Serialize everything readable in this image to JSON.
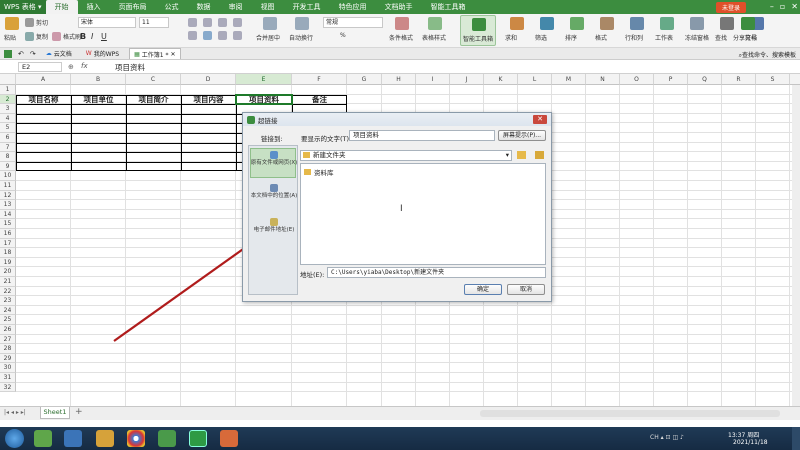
{
  "app": {
    "menu_label": "WPS 表格",
    "tabs": [
      "开始",
      "插入",
      "页面布局",
      "公式",
      "数据",
      "审阅",
      "视图",
      "开发工具",
      "特色应用",
      "文档助手",
      "智能工具箱"
    ],
    "active_tab": "开始",
    "login_label": "未登录"
  },
  "ribbon": {
    "paste": "粘贴",
    "cut": "剪切",
    "copy": "复制",
    "format_painter": "格式刷",
    "font_name": "宋体",
    "font_size": "11",
    "bold": "B",
    "italic": "I",
    "underline": "U",
    "merge_center": "合并居中",
    "wrap_text": "自动换行",
    "number_format": "常规",
    "percent": "%",
    "conditional_format": "条件格式",
    "table_style": "表格样式",
    "smart_toolbox": "智能工具箱",
    "sum": "求和",
    "filter": "筛选",
    "sort": "排序",
    "format": "格式",
    "row_col": "行和列",
    "worksheet": "工作表",
    "freeze": "冻结窗格",
    "find": "查找",
    "symbol": "符号",
    "share": "分享文档"
  },
  "doc_tabs": [
    {
      "label": "云文档",
      "active": false
    },
    {
      "label": "我的WPS",
      "active": false
    },
    {
      "label": "工作簿1 *",
      "active": true
    }
  ],
  "search_hint": "查找命令、搜索模板",
  "formula_bar": {
    "cell_ref": "E2",
    "fx": "fx",
    "content": "项目资料"
  },
  "columns": [
    "A",
    "B",
    "C",
    "D",
    "E",
    "F",
    "G",
    "H",
    "I",
    "J",
    "K",
    "L",
    "M",
    "N",
    "O",
    "P",
    "Q",
    "R",
    "S",
    "T"
  ],
  "rows": [
    "1",
    "2",
    "3",
    "4",
    "5",
    "6",
    "7",
    "8",
    "9",
    "10",
    "11",
    "12",
    "13",
    "14",
    "15",
    "16",
    "17",
    "18",
    "19",
    "20",
    "21",
    "22",
    "23",
    "24",
    "25",
    "26",
    "27",
    "28",
    "29",
    "30",
    "31",
    "32"
  ],
  "table_headers": [
    "项目名称",
    "项目单位",
    "项目简介",
    "项目内容",
    "项目资料",
    "备注"
  ],
  "dialog": {
    "title": "超链接",
    "link_to_label": "链接到:",
    "display_text_label": "要显示的文字(T):",
    "display_text_value": "项目资料",
    "screen_tip_button": "屏幕提示(P)...",
    "link_options": [
      "原有文件或网页(X)",
      "本文档中的位置(A)",
      "电子邮件地址(E)"
    ],
    "folder": "新建文件夹",
    "files": [
      "资料库"
    ],
    "address_label": "地址(E):",
    "address_value": "C:\\Users\\yiaba\\Desktop\\新建文件夹",
    "ok_button": "确定",
    "cancel_button": "取消"
  },
  "sheet_tabs": [
    "Sheet1"
  ],
  "taskbar": {
    "time": "13:37 周四",
    "date": "2021/11/18"
  },
  "colors": {
    "brand_green": "#3c8d3f",
    "arrow_red": "#b01c1c",
    "selected_cell": "#1e7a2a"
  }
}
